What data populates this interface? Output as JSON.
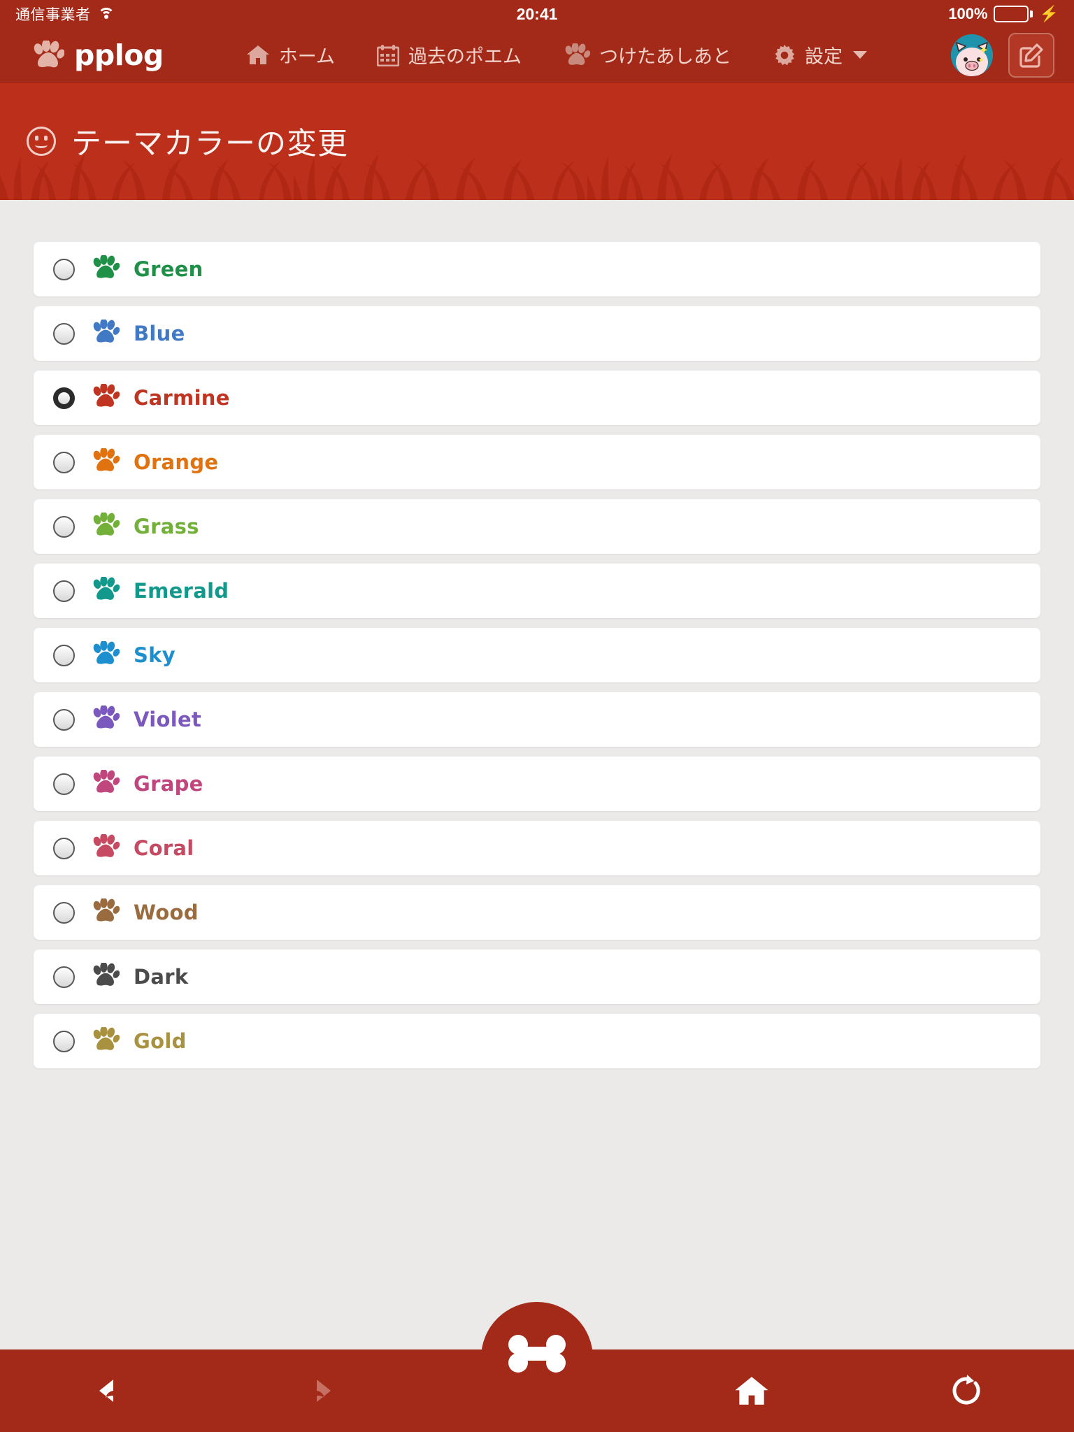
{
  "status_bar": {
    "carrier": "通信事業者",
    "wifi_icon": "wifi-icon",
    "time": "20:41",
    "battery_percent": "100%",
    "battery_icon": "battery-full-icon",
    "charging_icon": "lightning-bolt-icon"
  },
  "navbar": {
    "brand": "pplog",
    "brand_icon": "paw-print-icon",
    "items": [
      {
        "label": "ホーム",
        "icon": "home-icon"
      },
      {
        "label": "過去のポエム",
        "icon": "calendar-icon"
      },
      {
        "label": "つけたあしあと",
        "icon": "paw-print-icon"
      },
      {
        "label": "設定",
        "icon": "gear-icon",
        "has_caret": true
      }
    ],
    "avatar_icon": "user-avatar-pig",
    "compose_icon": "compose-edit-icon"
  },
  "banner": {
    "title": "テーマカラーの変更",
    "icon": "smiley-face-icon"
  },
  "theme_list": {
    "selected": "Carmine",
    "items": [
      {
        "label": "Green",
        "color": "#1e9048",
        "selected": false
      },
      {
        "label": "Blue",
        "color": "#4279c4",
        "selected": false
      },
      {
        "label": "Carmine",
        "color": "#c03522",
        "selected": true
      },
      {
        "label": "Orange",
        "color": "#e0730f",
        "selected": false
      },
      {
        "label": "Grass",
        "color": "#73b03a",
        "selected": false
      },
      {
        "label": "Emerald",
        "color": "#13998b",
        "selected": false
      },
      {
        "label": "Sky",
        "color": "#1e8fce",
        "selected": false
      },
      {
        "label": "Violet",
        "color": "#7b58bd",
        "selected": false
      },
      {
        "label": "Grape",
        "color": "#c0467e",
        "selected": false
      },
      {
        "label": "Coral",
        "color": "#c74a63",
        "selected": false
      },
      {
        "label": "Wood",
        "color": "#9a6b3e",
        "selected": false
      },
      {
        "label": "Dark",
        "color": "#4b4b4b",
        "selected": false
      },
      {
        "label": "Gold",
        "color": "#a8913f",
        "selected": false
      }
    ]
  },
  "tabbar": {
    "items": [
      {
        "name": "back",
        "icon": "arrow-left-icon",
        "enabled": true
      },
      {
        "name": "forward",
        "icon": "arrow-right-icon",
        "enabled": false
      },
      {
        "name": "home",
        "icon": "home-icon",
        "enabled": true
      },
      {
        "name": "reload",
        "icon": "refresh-icon",
        "enabled": true
      }
    ],
    "fab_icon": "bone-icon"
  },
  "colors": {
    "brand_dark": "#a32a19",
    "banner": "#bc2f1a",
    "page_bg": "#ece9e9",
    "card": "#ffffff",
    "nav_text": "#f2d4cd"
  }
}
